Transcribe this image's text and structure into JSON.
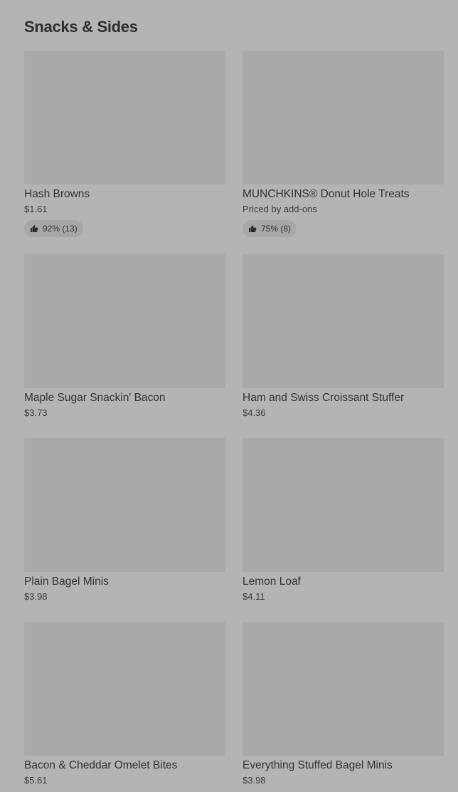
{
  "section": {
    "title": "Snacks & Sides"
  },
  "items": [
    {
      "name": "Hash Browns",
      "price": "$1.61",
      "rating": "92% (13)"
    },
    {
      "name": "MUNCHKINS® Donut Hole Treats",
      "price": "Priced by add-ons",
      "rating": "75% (8)"
    },
    {
      "name": "Maple Sugar Snackin' Bacon",
      "price": "$3.73"
    },
    {
      "name": "Ham and Swiss Croissant Stuffer",
      "price": "$4.36"
    },
    {
      "name": "Plain Bagel Minis",
      "price": "$3.98"
    },
    {
      "name": "Lemon Loaf",
      "price": "$4.11"
    },
    {
      "name": "Bacon & Cheddar Omelet Bites",
      "price": "$5.61"
    },
    {
      "name": "Everything Stuffed Bagel Minis",
      "price": "$3.98"
    }
  ],
  "icons": {
    "rating": "thumbs-up-icon"
  },
  "colors": {
    "background": "#b4b4b4",
    "thumbnail": "#a9a9a9",
    "text": "#2e2e2e"
  }
}
